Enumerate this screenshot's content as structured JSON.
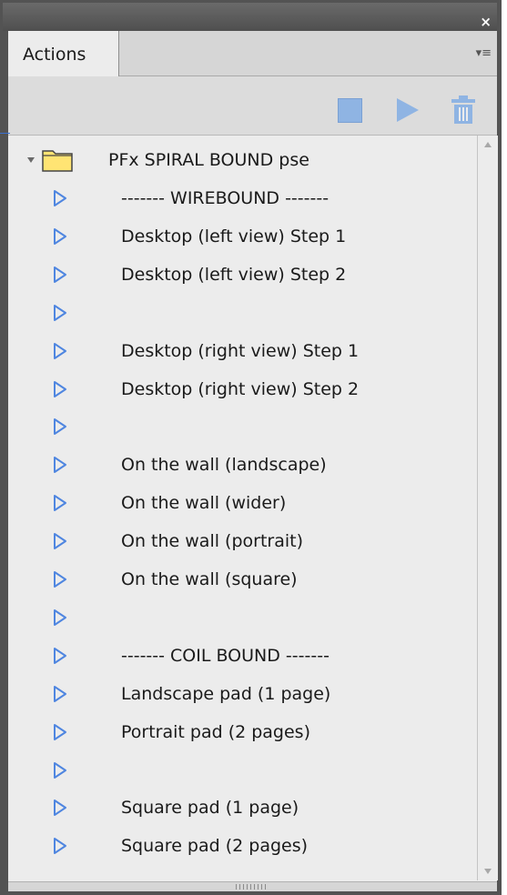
{
  "panel": {
    "close_glyph": "×",
    "tab_label": "Actions",
    "menu_glyph": "▾≡"
  },
  "toolbar": {
    "stop_icon": "stop-icon",
    "play_icon": "play-icon",
    "delete_icon": "trash-icon"
  },
  "set": {
    "name": "PFx SPIRAL BOUND pse",
    "expanded": true
  },
  "actions": [
    "------- WIREBOUND -------",
    "Desktop (left view) Step 1",
    "Desktop (left view) Step 2",
    "",
    "Desktop (right view) Step 1",
    "Desktop (right view) Step 2",
    "",
    "On the wall (landscape)",
    "On the wall (wider)",
    "On the wall (portrait)",
    "On the wall (square)",
    "",
    "------- COIL BOUND -------",
    "Landscape pad (1 page)",
    "Portrait pad (2 pages)",
    "",
    "Square pad (1 page)",
    "Square pad (2 pages)"
  ],
  "colors": {
    "action_arrow": "#4f86e0",
    "folder_fill": "#ffe473",
    "button_blue": "#8fb4e3"
  }
}
